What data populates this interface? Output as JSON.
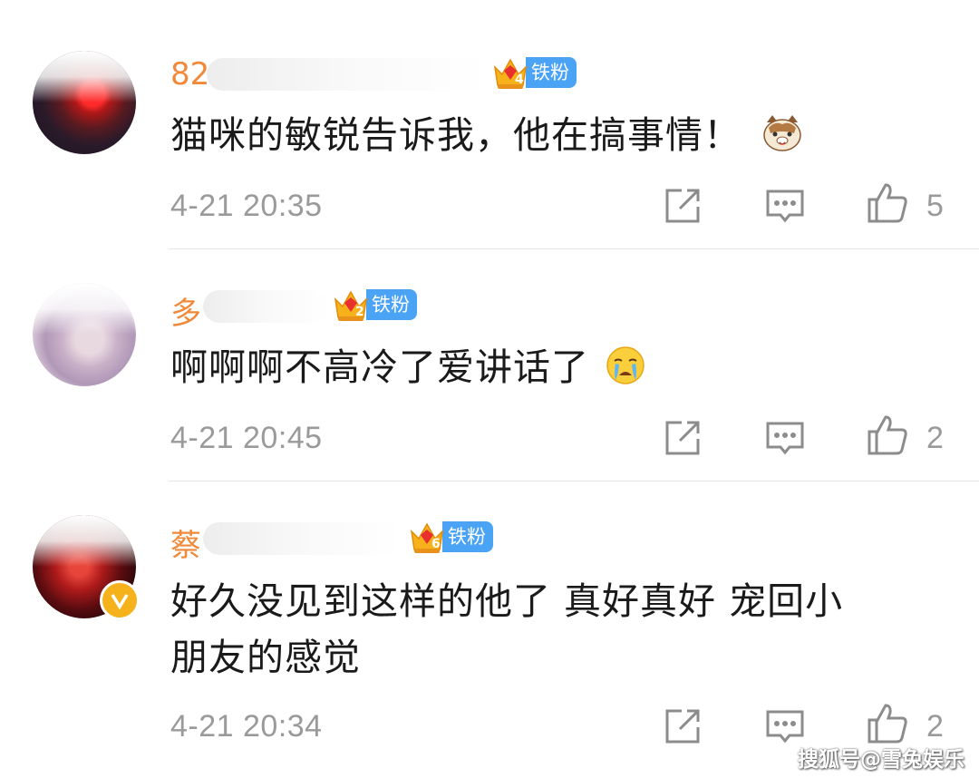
{
  "comments": [
    {
      "username": "82",
      "fan_label": "铁粉",
      "fan_level": "4",
      "text": "猫咪的敏锐告诉我，他在搞事情！",
      "emoji": "cat-face-icon",
      "timestamp": "4-21 20:35",
      "like_count": "5"
    },
    {
      "username": "多",
      "fan_label": "铁粉",
      "fan_level": "2",
      "text": "啊啊啊不高冷了爱讲话了",
      "emoji": "crying-face-icon",
      "timestamp": "4-21 20:45",
      "like_count": "2"
    },
    {
      "username": "蔡",
      "fan_label": "铁粉",
      "fan_level": "6",
      "verified": true,
      "text_line1": "好久没见到这样的他了 真好真好 宠回小",
      "text_line2": "朋友的感觉",
      "timestamp": "4-21 20:34",
      "like_count": "2"
    }
  ],
  "watermark": "搜狐号@雪兔娱乐",
  "colors": {
    "username": "#f08a3a",
    "fan_tag": "#4aa3f5",
    "meta_gray": "#9a9a9a",
    "verified": "#f6b21a"
  }
}
